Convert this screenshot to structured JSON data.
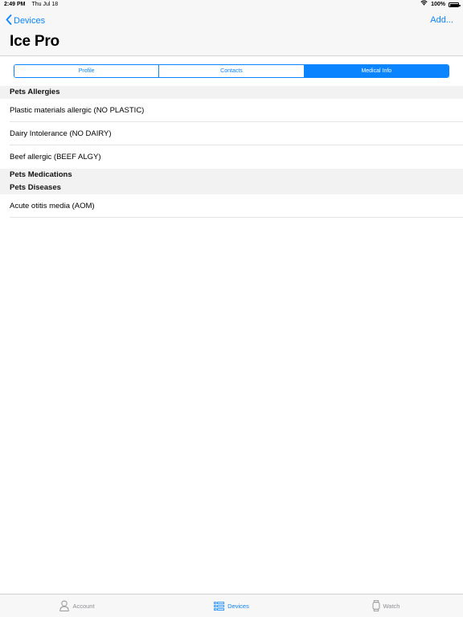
{
  "status_bar": {
    "time": "2:49 PM",
    "date": "Thu Jul 18",
    "wifi_icon": "wifi-icon",
    "battery_percent": "100%",
    "battery_level": 1.0
  },
  "nav": {
    "back_label": "Devices",
    "add_label": "Add...",
    "title": "Ice Pro"
  },
  "segments": [
    {
      "label": "Profile",
      "selected": false
    },
    {
      "label": "Contacts",
      "selected": false
    },
    {
      "label": "Medical Info",
      "selected": true
    }
  ],
  "sections": [
    {
      "header": "Pets Allergies",
      "rows": [
        "Plastic materials allergic (NO PLASTIC)",
        "Dairy Intolerance (NO DAIRY)",
        "Beef allergic (BEEF ALGY)"
      ]
    },
    {
      "header": "Pets Medications",
      "rows": []
    },
    {
      "header": "Pets Diseases",
      "rows": [
        "Acute otitis media (AOM)"
      ]
    }
  ],
  "tab_bar": [
    {
      "label": "Account",
      "icon": "person-icon",
      "active": false
    },
    {
      "label": "Devices",
      "icon": "devices-list-icon",
      "active": true
    },
    {
      "label": "Watch",
      "icon": "watch-icon",
      "active": false
    }
  ],
  "colors": {
    "accent": "#0a84ff",
    "inactive": "#8e8e93",
    "section_bg": "#f2f2f2",
    "bar_bg": "#f7f7f7"
  }
}
